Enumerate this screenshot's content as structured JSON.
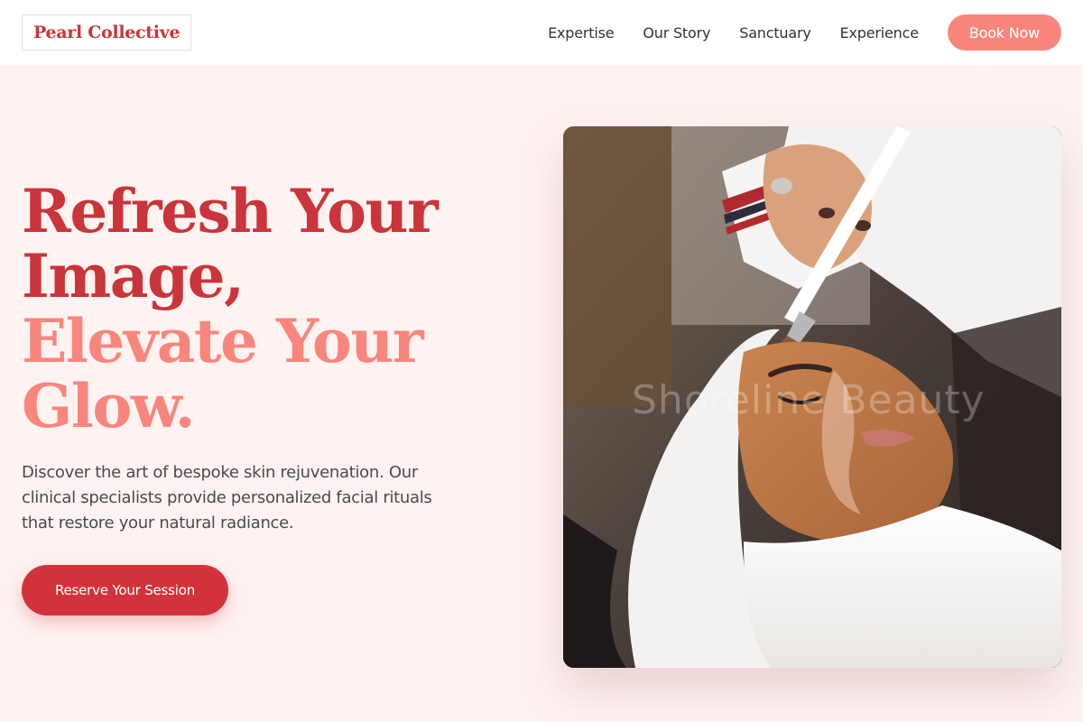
{
  "header": {
    "logo": "Pearl Collective",
    "nav": [
      "Expertise",
      "Our Story",
      "Sanctuary",
      "Experience"
    ],
    "cta": "Book Now"
  },
  "hero": {
    "title_line1": "Refresh Your",
    "title_line2": "Image,",
    "title_line3": "Elevate Your",
    "title_line4": "Glow.",
    "description": "Discover the art of bespoke skin rejuvenation. Our clinical specialists provide personalized facial rituals that restore your natural radiance.",
    "button": "Reserve Your Session"
  },
  "image": {
    "watermark": "Shoreline Beauty",
    "icon": "facial-treatment-photo"
  },
  "colors": {
    "primary": "#c9353a",
    "accent": "#f8867c",
    "background": "#fff3f2"
  }
}
